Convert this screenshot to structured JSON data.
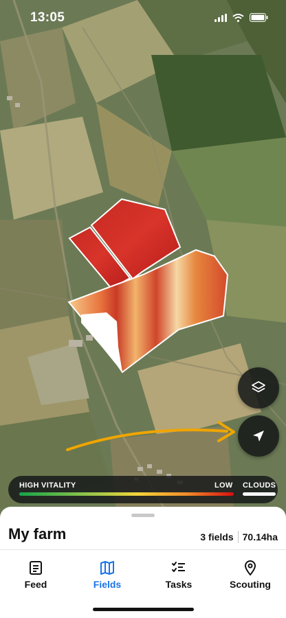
{
  "status_bar": {
    "time": "13:05"
  },
  "legend": {
    "high_label": "HIGH VITALITY",
    "low_label": "LOW",
    "clouds_label": "CLOUDS"
  },
  "farm": {
    "title": "My farm",
    "fields_count": "3 fields",
    "area": "70.14ha"
  },
  "nav": {
    "items": [
      {
        "label": "Feed",
        "icon": "document-icon"
      },
      {
        "label": "Fields",
        "icon": "map-icon",
        "active": true
      },
      {
        "label": "Tasks",
        "icon": "checklist-icon"
      },
      {
        "label": "Scouting",
        "icon": "location-pin-icon"
      }
    ]
  },
  "colors": {
    "accent": "#1a73e8",
    "arrow": "#f0a500",
    "vitality_high": "#16a34a",
    "vitality_low": "#d90f0f",
    "field_outline": "#ffffff"
  }
}
